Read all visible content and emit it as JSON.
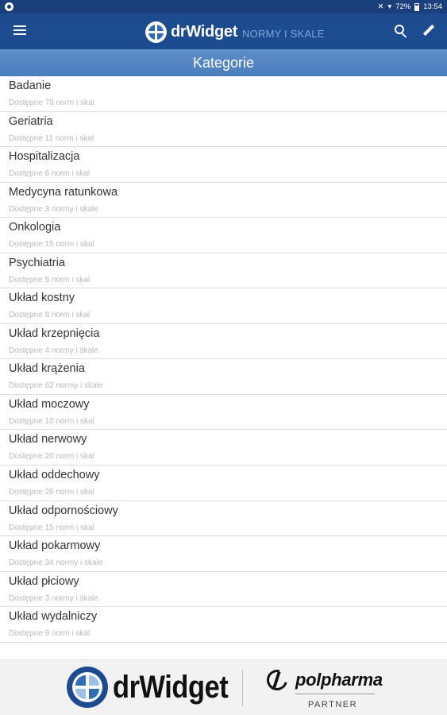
{
  "status_bar": {
    "time": "13:54",
    "battery": "72%"
  },
  "app_bar": {
    "brand_name": "drWidget",
    "brand_sub": "NORMY I SKALE",
    "icons": [
      "menu-icon",
      "search-icon",
      "edit-icon"
    ]
  },
  "section": {
    "title": "Kategorie"
  },
  "categories": [
    {
      "title": "Badanie",
      "subtitle": "Dostępne 78 norm i skal"
    },
    {
      "title": "Geriatria",
      "subtitle": "Dostępne 11 norm i skal"
    },
    {
      "title": "Hospitalizacja",
      "subtitle": "Dostępne 6 norm i skal"
    },
    {
      "title": "Medycyna ratunkowa",
      "subtitle": "Dostępne 3 normy i skale"
    },
    {
      "title": "Onkologia",
      "subtitle": "Dostępne 15 norm i skal"
    },
    {
      "title": "Psychiatria",
      "subtitle": "Dostępne 5 norm i skal"
    },
    {
      "title": "Układ kostny",
      "subtitle": "Dostępne 8 norm i skal"
    },
    {
      "title": "Układ krzepnięcia",
      "subtitle": "Dostępne 4 normy i skale"
    },
    {
      "title": "Układ krążenia",
      "subtitle": "Dostępne 62 normy i skale"
    },
    {
      "title": "Układ moczowy",
      "subtitle": "Dostępne 10 norm i skal"
    },
    {
      "title": "Układ nerwowy",
      "subtitle": "Dostępne 20 norm i skal"
    },
    {
      "title": "Układ oddechowy",
      "subtitle": "Dostępne 26 norm i skal"
    },
    {
      "title": "Układ odpornościowy",
      "subtitle": "Dostępne 15 norm i skal"
    },
    {
      "title": "Układ pokarmowy",
      "subtitle": "Dostępne 34 normy i skale"
    },
    {
      "title": "Układ płciowy",
      "subtitle": "Dostępne 3 normy i skale"
    },
    {
      "title": "Układ wydalniczy",
      "subtitle": "Dostępne 9 norm i skal"
    }
  ],
  "footer": {
    "brand": "drWidget",
    "partner_name": "polpharma",
    "partner_label": "PARTNER"
  },
  "colors": {
    "app_bar": "#1d4b8f",
    "status_bar": "#1b3f7a",
    "section_header": "#4a7dbd"
  }
}
